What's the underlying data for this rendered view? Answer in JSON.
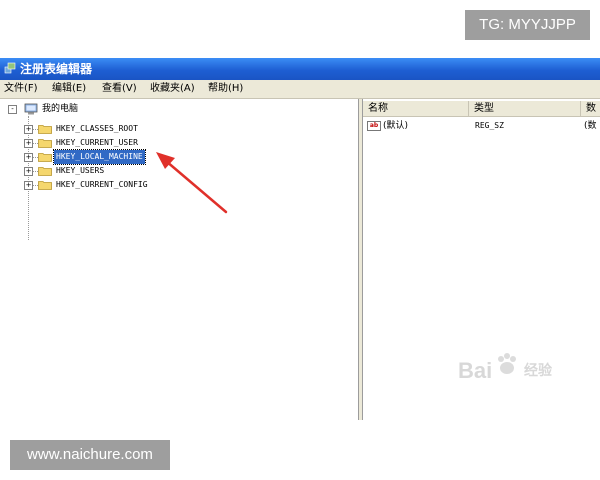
{
  "badges": {
    "top_right": "TG: MYYJJPP",
    "bottom_left": "www.naichure.com"
  },
  "window": {
    "title": "注册表编辑器",
    "title_icon": "registry-editor-icon",
    "titlebar_color": "#1e5fd3"
  },
  "menubar": {
    "items": [
      "文件(F)",
      "编辑(E)",
      "查看(V)",
      "收藏夹(A)",
      "帮助(H)"
    ]
  },
  "tree": {
    "root": {
      "label": "我的电脑",
      "icon": "computer-icon",
      "expander": "-"
    },
    "keys": [
      {
        "label": "HKEY_CLASSES_ROOT",
        "expander": "+",
        "selected": false
      },
      {
        "label": "HKEY_CURRENT_USER",
        "expander": "+",
        "selected": false
      },
      {
        "label": "HKEY_LOCAL_MACHINE",
        "expander": "+",
        "selected": true
      },
      {
        "label": "HKEY_USERS",
        "expander": "+",
        "selected": false
      },
      {
        "label": "HKEY_CURRENT_CONFIG",
        "expander": "+",
        "selected": false
      }
    ],
    "selection_color": "#316ac5"
  },
  "list": {
    "columns": [
      "名称",
      "类型",
      "数"
    ],
    "rows": [
      {
        "icon": "string-value-icon",
        "icon_text": "ab",
        "name": "(默认)",
        "type": "REG_SZ",
        "data": "(数"
      }
    ]
  },
  "annotation": {
    "arrow_color": "#e0302a",
    "arrow_icon": "red-pointer-arrow"
  },
  "watermark": {
    "text": "Bai",
    "sub": "经验"
  }
}
